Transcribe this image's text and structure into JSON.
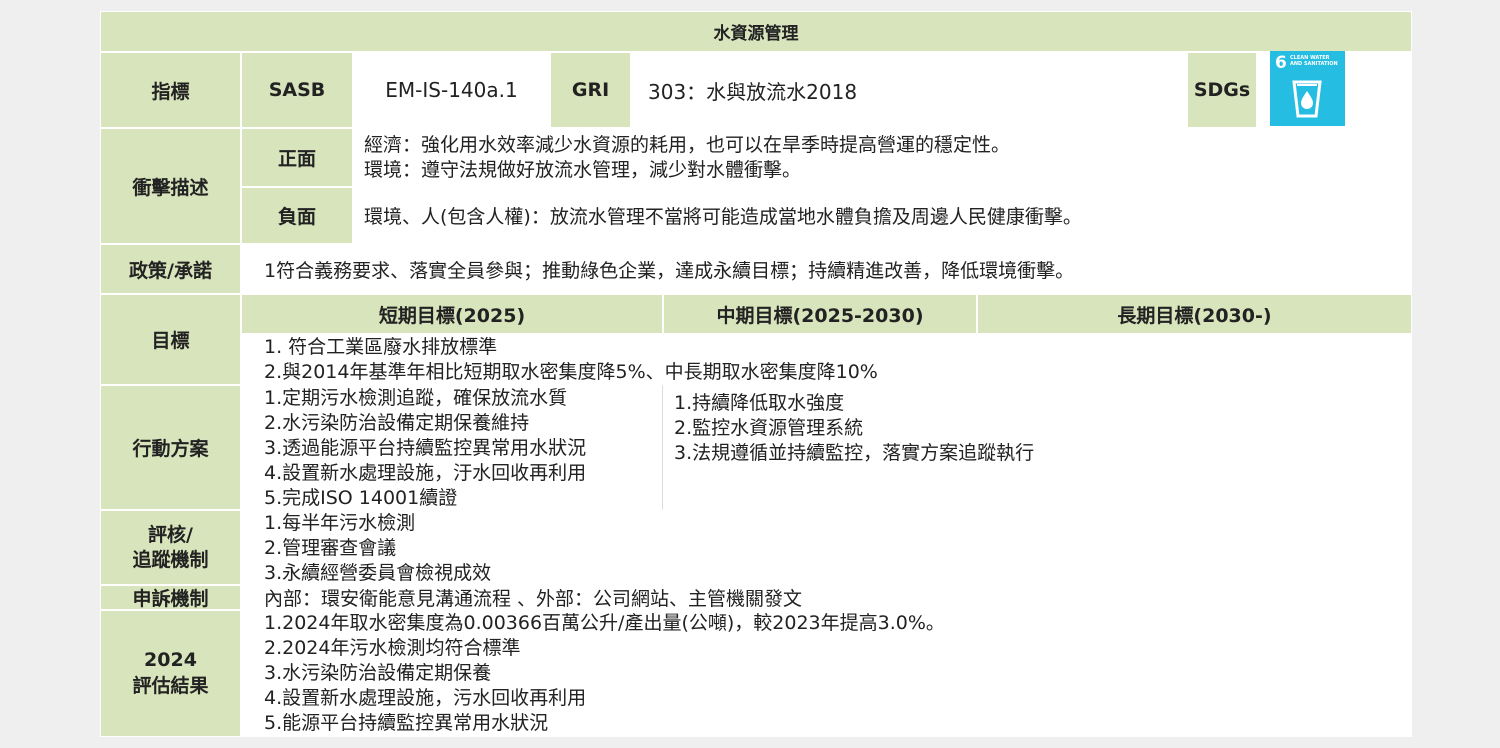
{
  "colors": {
    "header_bg": "#d8e4bc",
    "page_bg": "#efefef",
    "sdg_bg": "#26bde2"
  },
  "table": {
    "title": "水資源管理",
    "indicator": {
      "label": "指標",
      "sasb_label": "SASB",
      "sasb_value": "EM-IS-140a.1",
      "gri_label": "GRI",
      "gri_value": "303：水與放流水2018",
      "sdgs_label": "SDGs",
      "sdg_icon": {
        "number": "6",
        "caption_line1": "CLEAN WATER",
        "caption_line2": "AND SANITATION",
        "icon": "water-glass-icon"
      }
    },
    "impact": {
      "label": "衝擊描述",
      "positive_label": "正面",
      "positive_lines": [
        "經濟：強化用水效率減少水資源的耗用，也可以在旱季時提高營運的穩定性。",
        "環境：遵守法規做好放流水管理，減少對水體衝擊。"
      ],
      "negative_label": "負面",
      "negative_text": "環境、人(包含人權)：放流水管理不當將可能造成當地水體負擔及周邊人民健康衝擊。"
    },
    "policy": {
      "label": "政策/承諾",
      "text": "1符合義務要求、落實全員參與；推動綠色企業，達成永續目標；持續精進改善，降低環境衝擊。"
    },
    "goals": {
      "label": "目標",
      "short_label": "短期目標(2025)",
      "mid_label": "中期目標(2025-2030)",
      "long_label": "長期目標(2030-)",
      "lines": [
        "1. 符合工業區廢水排放標準",
        "2.與2014年基準年相比短期取水密集度降5%、中長期取水密集度降10%"
      ]
    },
    "actions": {
      "label": "行動方案",
      "short_lines": [
        "1.定期污水檢測追蹤，確保放流水質",
        "2.水污染防治設備定期保養維持",
        "3.透過能源平台持續監控異常用水狀況",
        "4.設置新水處理設施，汙水回收再利用",
        "5.完成ISO 14001續證"
      ],
      "mid_long_lines": [
        "1.持續降低取水強度",
        "2.監控水資源管理系統",
        "3.法規遵循並持續監控，落實方案追蹤執行"
      ]
    },
    "review": {
      "label_line1": "評核/",
      "label_line2": "追蹤機制",
      "lines": [
        "1.每半年污水檢測",
        "2.管理審查會議",
        "3.永續經營委員會檢視成效"
      ]
    },
    "grievance": {
      "label": "申訴機制",
      "text": "內部：環安衛能意見溝通流程 、外部：公司網站、主管機關發文"
    },
    "results": {
      "label_line1": "2024",
      "label_line2": "評估結果",
      "lines": [
        "1.2024年取水密集度為0.00366百萬公升/產出量(公噸)，較2023年提高3.0%。",
        "2.2024年污水檢測均符合標準",
        "3.水污染防治設備定期保養",
        "4.設置新水處理設施，污水回收再利用",
        "5.能源平台持續監控異常用水狀況"
      ]
    }
  }
}
